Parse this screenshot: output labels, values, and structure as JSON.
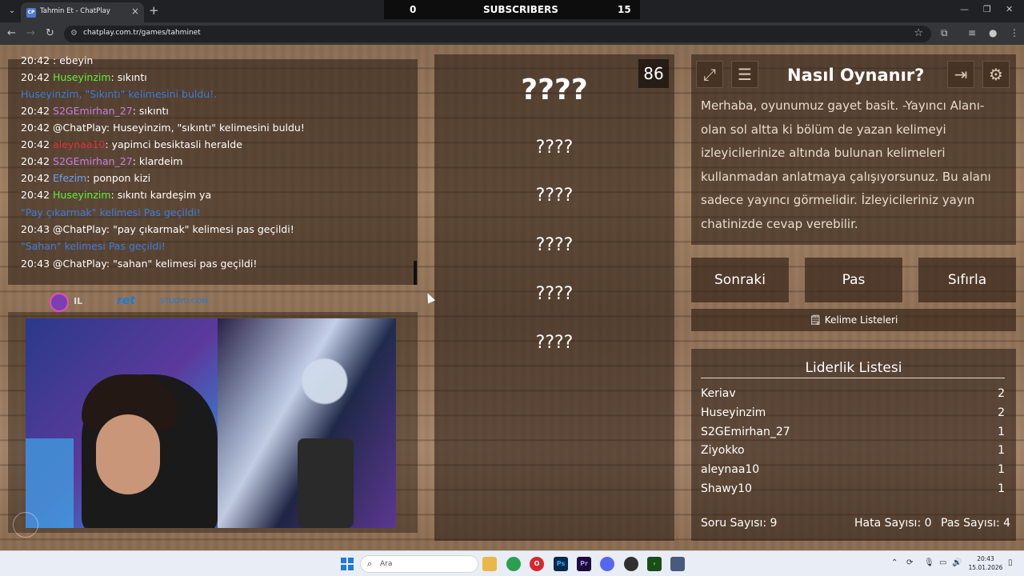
{
  "browser": {
    "tab_title": "Tahmin Et - ChatPlay",
    "favicon_text": "CP",
    "url": "chatplay.com.tr/games/tahminet",
    "icons": [
      "chevron-down-icon",
      "close-icon",
      "plus-icon",
      "back-icon",
      "forward-icon",
      "reload-icon",
      "site-info-icon",
      "star-icon",
      "extensions-icon",
      "menu-icon"
    ]
  },
  "overlay": {
    "left_count": "0",
    "label": "SUBSCRIBERS",
    "right_count": "15"
  },
  "chat": {
    "lines": [
      {
        "time": "20:42",
        "user": "",
        "user_color": "#e0313a",
        "text": ": ebeyin"
      },
      {
        "time": "20:42",
        "user": "Huseyinzim",
        "user_color": "#5ff03a",
        "text": ": sıkıntı"
      },
      {
        "time": "",
        "user": "",
        "user_color": "",
        "text": "",
        "system": "Huseyinzim, \"Sıkıntı\" kelimesini buldu!.",
        "system_color": "#3b7ed8"
      },
      {
        "time": "20:42",
        "user": "S2GEmirhan_27",
        "user_color": "#c77ee0",
        "text": ": sıkıntı"
      },
      {
        "time": "20:42",
        "user": "",
        "user_color": "",
        "text": "@ChatPlay: Huseyinzim, \"sıkıntı\" kelimesini buldu!"
      },
      {
        "time": "20:42",
        "user": "aleynaa10",
        "user_color": "#e0313a",
        "text": ": yapimci besiktasli heralde"
      },
      {
        "time": "20:42",
        "user": "S2GEmirhan_27",
        "user_color": "#c77ee0",
        "text": ": klardeim"
      },
      {
        "time": "20:42",
        "user": "Efezim",
        "user_color": "#6fa0f0",
        "text": ": ponpon kizi"
      },
      {
        "time": "20:42",
        "user": "Huseyinzim",
        "user_color": "#5ff03a",
        "text": ": sıkıntı kardeşim ya"
      },
      {
        "time": "",
        "user": "",
        "user_color": "",
        "text": "",
        "system": "\"Pay çıkarmak\" kelimesi Pas geçildi!",
        "system_color": "#3b7ed8"
      },
      {
        "time": "20:43",
        "user": "",
        "user_color": "",
        "text": "@ChatPlay: \"pay çıkarmak\" kelimesi pas geçildi!"
      },
      {
        "time": "",
        "user": "",
        "user_color": "",
        "text": "",
        "system": "\"Sahan\" kelimesi Pas geçildi!",
        "system_color": "#3b7ed8"
      },
      {
        "time": "20:43",
        "user": "",
        "user_color": "",
        "text": "@ChatPlay: \"sahan\" kelimesi pas geçildi!"
      }
    ]
  },
  "stream": {
    "logo_text": "IL",
    "sponsor_text": "ret",
    "sponsor_sub": "STUDYO.COM"
  },
  "game": {
    "timer": "86",
    "main_word": "????",
    "words": [
      "????",
      "????",
      "????",
      "????",
      "????"
    ]
  },
  "howto": {
    "title": "Nasıl Oynanır?",
    "text": "Merhaba, oyunumuz gayet basit. -Yayıncı Alanı- olan sol altta ki bölüm de yazan kelimeyi izleyicilerinize altında bulunan kelimeleri kullanmadan anlatmaya çalışıyorsunuz. Bu alanı sadece yayıncı görmelidir. İzleyicileriniz yayın chatinizde cevap verebilir.",
    "icons": [
      "fullscreen-icon",
      "document-icon",
      "logout-icon",
      "gear-icon"
    ]
  },
  "actions": {
    "next": "Sonraki",
    "pass": "Pas",
    "reset": "Sıfırla",
    "word_lists": "Kelime Listeleri"
  },
  "leaderboard": {
    "title": "Liderlik Listesi",
    "rows": [
      {
        "name": "Keriav",
        "score": "2"
      },
      {
        "name": "Huseyinzim",
        "score": "2"
      },
      {
        "name": "S2GEmirhan_27",
        "score": "1"
      },
      {
        "name": "Ziyokko",
        "score": "1"
      },
      {
        "name": "aleynaa10",
        "score": "1"
      },
      {
        "name": "Shawy10",
        "score": "1"
      }
    ],
    "question_count": "Soru Sayısı: 9",
    "error_count": "Hata Sayısı: 0",
    "pass_count": "Pas Sayısı: 4"
  },
  "taskbar": {
    "search_placeholder": "Ara",
    "time": "20:43",
    "date": "15.01.2026",
    "apps": [
      "file-explorer-icon",
      "chrome-icon",
      "opera-icon",
      "photoshop-icon",
      "premiere-icon",
      "discord-icon",
      "obs-icon",
      "terminal-icon",
      "shield-icon"
    ]
  }
}
